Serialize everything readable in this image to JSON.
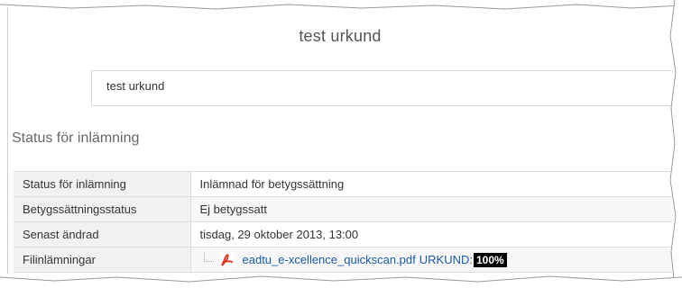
{
  "assignment": {
    "title": "test urkund",
    "description": "test urkund"
  },
  "submission_status": {
    "heading": "Status för inlämning",
    "rows": [
      {
        "label": "Status för inlämning",
        "value": "Inlämnad för betygssättning"
      },
      {
        "label": "Betygssättningsstatus",
        "value": "Ej betygssatt"
      },
      {
        "label": "Senast ändrad",
        "value": "tisdag, 29 oktober 2013, 13:00"
      },
      {
        "label": "Filinlämningar"
      }
    ],
    "file": {
      "icon": "pdf-icon",
      "name": "eadtu_e-xcellence_quickscan.pdf",
      "urkund_label": "URKUND:",
      "urkund_score": "100%"
    }
  },
  "colors": {
    "submitted_bg": "#d3edd6",
    "label_bg": "#f1f1f1",
    "link": "#1a5aa8",
    "pdf_red": "#e0301e"
  }
}
